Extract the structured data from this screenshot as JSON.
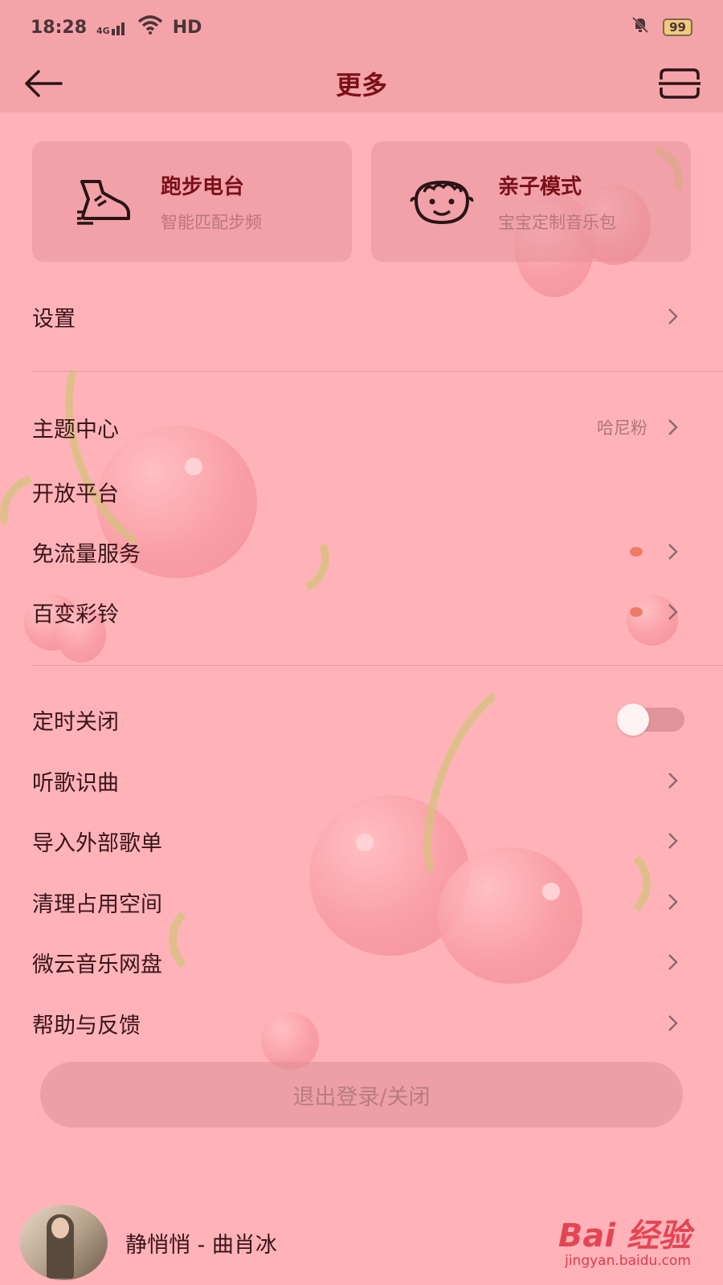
{
  "status_bar": {
    "time": "18:28",
    "network": "4G",
    "hd": "HD",
    "battery": "99"
  },
  "header": {
    "title": "更多"
  },
  "cards": [
    {
      "title": "跑步电台",
      "subtitle": "智能匹配步频",
      "icon": "running-shoe-icon"
    },
    {
      "title": "亲子模式",
      "subtitle": "宝宝定制音乐包",
      "icon": "baby-face-icon"
    }
  ],
  "menu": {
    "settings": "设置",
    "theme_center": "主题中心",
    "theme_value": "哈尼粉",
    "open_platform": "开放平台",
    "free_data": "免流量服务",
    "ringtone": "百变彩铃",
    "sleep_timer": "定时关闭",
    "song_recognition": "听歌识曲",
    "import_playlist": "导入外部歌单",
    "clear_space": "清理占用空间",
    "weiyun_disk": "微云音乐网盘",
    "help_feedback": "帮助与反馈"
  },
  "logout_label": "退出登录/关闭",
  "player": {
    "song": "静悄悄 - 曲肖冰"
  },
  "watermark": {
    "main": "Bai  经验",
    "sub": "jingyan.baidu.com"
  },
  "colors": {
    "background": "#ffb3b9",
    "accent_title": "#7a1018",
    "dot": "#f07a66"
  }
}
